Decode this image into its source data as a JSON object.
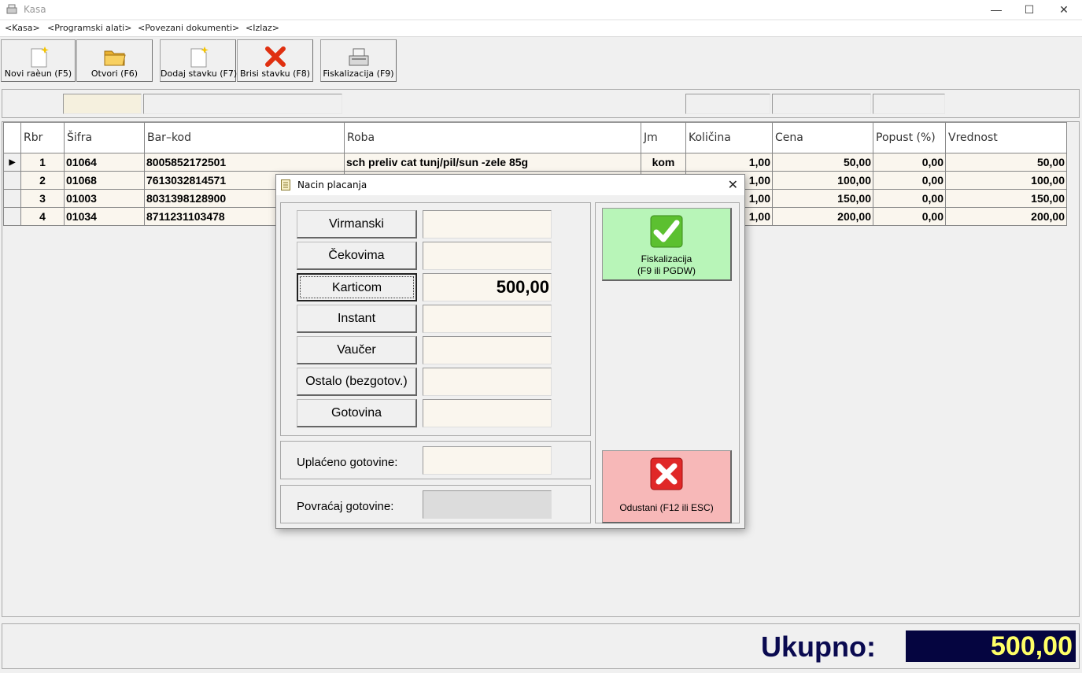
{
  "window": {
    "title": "Kasa",
    "controls": {
      "minimize": "—",
      "maximize": "☐",
      "close": "✕"
    }
  },
  "menu": [
    "<Kasa>",
    "<Programski alati>",
    "<Povezani dokumenti>",
    "<Izlaz>"
  ],
  "toolbar": {
    "new_invoice": "Novi raèun (F5)",
    "open": "Otvori (F6)",
    "add_item": "Dodaj stavku (F7)",
    "delete_item": "Brisi stavku (F8)",
    "fiscalize": "Fiskalizacija (F9)"
  },
  "grid": {
    "columns": [
      "Rbr",
      "Šifra",
      "Bar–kod",
      "Roba",
      "Jm",
      "Količina",
      "Cena",
      "Popust  (%)",
      "Vrednost"
    ],
    "rows": [
      {
        "rbr": "1",
        "sifra": "01064",
        "barkod": "8005852172501",
        "roba": "sch preliv cat tunj/pil/sun -zele 85g",
        "jm": "kom",
        "kolicina": "1,00",
        "cena": "50,00",
        "popust": "0,00",
        "vrednost": "50,00"
      },
      {
        "rbr": "2",
        "sifra": "01068",
        "barkod": "7613032814571",
        "roba": "",
        "jm": "",
        "kolicina": "1,00",
        "cena": "100,00",
        "popust": "0,00",
        "vrednost": "100,00"
      },
      {
        "rbr": "3",
        "sifra": "01003",
        "barkod": "8031398128900",
        "roba": "",
        "jm": "",
        "kolicina": "1,00",
        "cena": "150,00",
        "popust": "0,00",
        "vrednost": "150,00"
      },
      {
        "rbr": "4",
        "sifra": "01034",
        "barkod": "8711231103478",
        "roba": "",
        "jm": "",
        "kolicina": "1,00",
        "cena": "200,00",
        "popust": "0,00",
        "vrednost": "200,00"
      }
    ]
  },
  "total": {
    "label": "Ukupno:",
    "value": "500,00"
  },
  "dialog": {
    "title": "Nacin placanja",
    "methods": [
      {
        "label": "Virmanski",
        "value": ""
      },
      {
        "label": "Čekovima",
        "value": ""
      },
      {
        "label": "Karticom",
        "value": "500,00"
      },
      {
        "label": "Instant",
        "value": ""
      },
      {
        "label": "Vaučer",
        "value": ""
      },
      {
        "label": "Ostalo (bezgotov.)",
        "value": ""
      },
      {
        "label": "Gotovina",
        "value": ""
      }
    ],
    "cash_paid_label": "Uplaćeno gotovine:",
    "cash_paid_value": "",
    "change_label": "Povraćaj gotovine:",
    "change_value": "",
    "fiscalize_line1": "Fiskalizacija",
    "fiscalize_line2": "(F9 ili PGDW)",
    "cancel_label": "Odustani (F12 ili ESC)",
    "close": "✕"
  },
  "colors": {
    "fiscalize_bg": "#b8f5b8",
    "cancel_bg": "#f7b8b8",
    "total_bg": "#050540",
    "total_fg": "#ffff66"
  }
}
